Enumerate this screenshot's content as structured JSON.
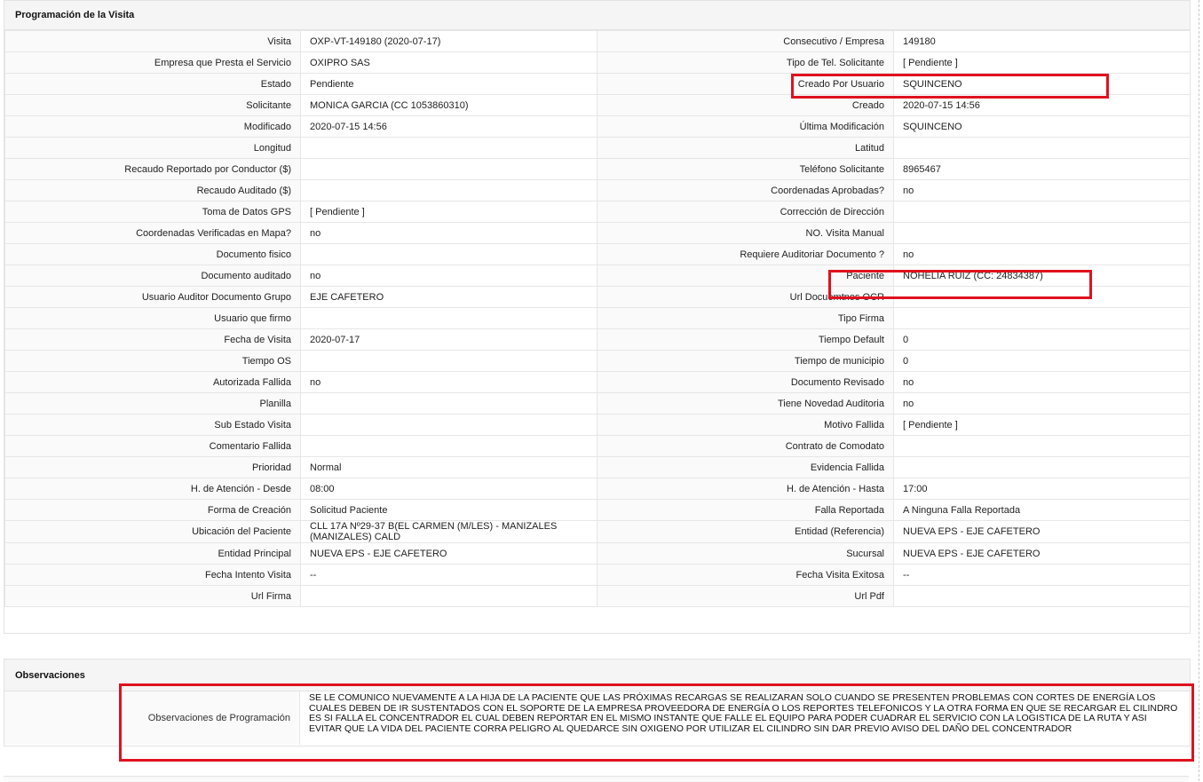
{
  "visit_panel": {
    "title": "Programación de la Visita",
    "rows": [
      [
        "Visita",
        "OXP-VT-149180 (2020-07-17)",
        "Consecutivo / Empresa",
        "149180"
      ],
      [
        "Empresa que Presta el Servicio",
        "OXIPRO SAS",
        "Tipo de Tel. Solicitante",
        "[ Pendiente ]"
      ],
      [
        "Estado",
        "Pendiente",
        "Creado Por Usuario",
        "SQUINCENO"
      ],
      [
        "Solicitante",
        "MONICA GARCIA (CC 1053860310)",
        "Creado",
        "2020-07-15 14:56"
      ],
      [
        "Modificado",
        "2020-07-15 14:56",
        "Última Modificación",
        " SQUINCENO"
      ],
      [
        "Longitud",
        "",
        "Latitud",
        ""
      ],
      [
        "Recaudo Reportado por Conductor ($)",
        "",
        "Teléfono Solicitante",
        "8965467"
      ],
      [
        "Recaudo Auditado ($)",
        "",
        "Coordenadas Aprobadas?",
        " no"
      ],
      [
        "Toma de Datos GPS",
        "[ Pendiente ]",
        "Corrección de Dirección",
        ""
      ],
      [
        "Coordenadas Verificadas en Mapa?",
        " no",
        "NO. Visita Manual",
        ""
      ],
      [
        "Documento fisico",
        "",
        "Requiere Auditoriar Documento ?",
        " no"
      ],
      [
        "Documento auditado",
        " no",
        "Paciente",
        "NOHELIA RUIZ (CC: 24834387)"
      ],
      [
        "Usuario Auditor Documento Grupo",
        "EJE CAFETERO",
        "Url Docuemtnos OCR",
        ""
      ],
      [
        "Usuario que firmo",
        "",
        "Tipo Firma",
        ""
      ],
      [
        "Fecha de Visita",
        " 2020-07-17",
        "Tiempo Default",
        "0"
      ],
      [
        "Tiempo OS",
        "",
        "Tiempo de municipio",
        "0"
      ],
      [
        "Autorizada Fallida",
        " no",
        "Documento Revisado",
        " no"
      ],
      [
        "Planilla",
        "",
        "Tiene Novedad Auditoria",
        " no"
      ],
      [
        "Sub Estado Visita",
        "",
        "Motivo Fallida",
        "[ Pendiente ]"
      ],
      [
        "Comentario Fallida",
        "",
        "Contrato de Comodato",
        ""
      ],
      [
        "Prioridad",
        "Normal",
        "Evidencia Fallida",
        ""
      ],
      [
        "H. de Atención - Desde",
        "08:00",
        "H. de Atención - Hasta",
        "17:00"
      ],
      [
        "Forma de Creación",
        "Solicitud Paciente",
        "Falla Reportada",
        "A Ninguna Falla Reportada"
      ],
      [
        "Ubicación del Paciente",
        "CLL 17A Nº29-37 B(EL CARMEN (M/LES) - MANIZALES (MANIZALES) CALD",
        "Entidad (Referencia)",
        "NUEVA EPS - EJE CAFETERO"
      ],
      [
        "Entidad Principal",
        "NUEVA EPS - EJE CAFETERO",
        "Sucursal",
        "NUEVA EPS - EJE CAFETERO"
      ],
      [
        "Fecha Intento Visita",
        "--",
        "Fecha Visita Exitosa",
        "--"
      ],
      [
        "Url Firma",
        "",
        "Url Pdf",
        ""
      ]
    ]
  },
  "observations_panel": {
    "title": "Observaciones",
    "label": "Observaciones de Programación",
    "text": "  SE LE COMUNICO NUEVAMENTE A LA HIJA DE LA PACIENTE QUE LAS PRÓXIMAS RECARGAS SE REALIZARAN SOLO CUANDO SE PRESENTEN PROBLEMAS CON CORTES DE ENERGÍA LOS CUALES DEBEN DE IR SUSTENTADOS CON EL SOPORTE DE LA EMPRESA PROVEEDORA DE ENERGÍA O LOS REPORTES TELEFONICOS Y LA OTRA FORMA EN QUE SE RECARGAR EL CILINDRO ES SI FALLA EL CONCENTRADOR EL CUAL DEBEN REPORTAR EN EL MISMO INSTANTE QUE FALLE EL EQUIPO PARA PODER CUADRAR EL SERVICIO CON LA LOGISTICA DE LA RUTA Y ASI EVITAR QUE LA VIDA DEL PACIENTE CORRA PELIGRO AL QUEDARCE SIN OXIGENO POR UTILIZAR EL CILINDRO SIN DAR PREVIO AVISO DEL DAÑO DEL CONCENTRADOR"
  },
  "highlight_color": "#e0111e"
}
